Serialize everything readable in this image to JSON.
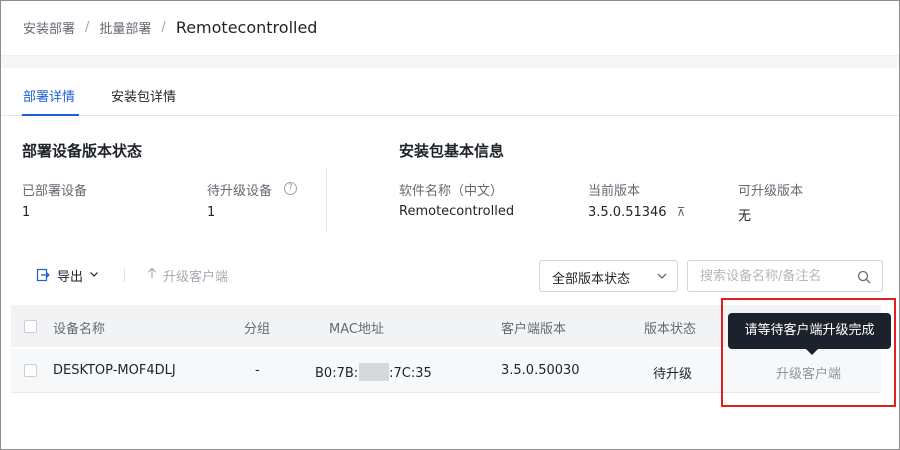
{
  "breadcrumb": {
    "items": [
      "安装部署",
      "批量部署"
    ],
    "separator": "/",
    "current": "Remotecontrolled"
  },
  "tabs": [
    {
      "label": "部署详情",
      "active": true
    },
    {
      "label": "安装包详情",
      "active": false
    }
  ],
  "deploy_status": {
    "title": "部署设备版本状态",
    "deployed_label": "已部署设备",
    "deployed_value": "1",
    "pending_label": "待升级设备",
    "pending_value": "1",
    "help_icon": "question-circle-icon"
  },
  "package_info": {
    "title": "安装包基本信息",
    "name_label": "软件名称（中文）",
    "name_value": "Remotecontrolled",
    "current_version_label": "当前版本",
    "current_version_value": "3.5.0.51346",
    "current_version_mark": "⌃",
    "upgradable_label": "可升级版本",
    "upgradable_value": "无"
  },
  "toolbar": {
    "export_label": "导出",
    "upgrade_label": "升级客户端",
    "version_filter": "全部版本状态",
    "search_placeholder": "搜索设备名称/备注名"
  },
  "table": {
    "columns": [
      "设备名称",
      "分组",
      "MAC地址",
      "客户端版本",
      "版本状态"
    ],
    "rows": [
      {
        "device_name": "DESKTOP-MOF4DLJ",
        "group": "-",
        "mac_prefix": "B0:7B:",
        "mac_suffix": ":7C:35",
        "client_version": "3.5.0.50030",
        "status": "待升级",
        "action": "升级客户端"
      }
    ]
  },
  "tooltip": {
    "text": "请等待客户端升级完成"
  },
  "colors": {
    "accent": "#1f5fd6",
    "tooltip_bg": "#1c222c",
    "highlight": "#e02020"
  }
}
